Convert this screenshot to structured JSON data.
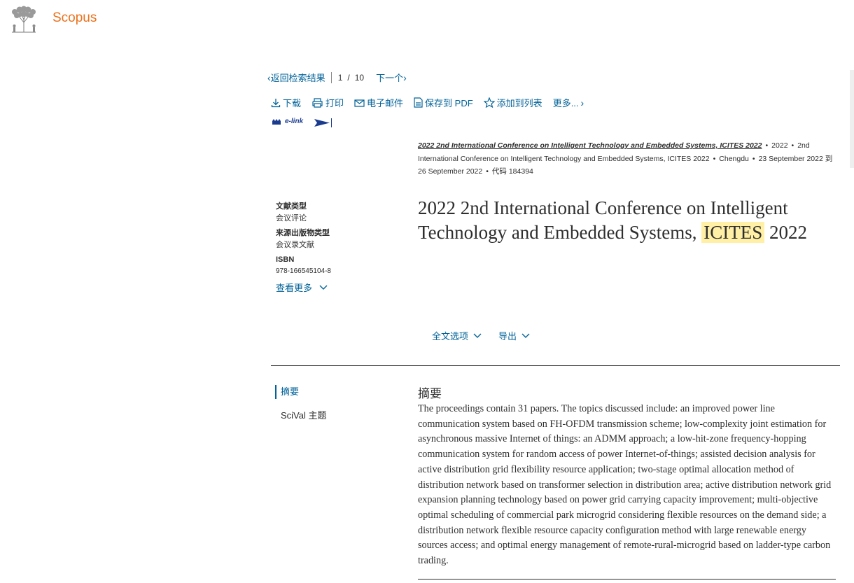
{
  "brand": "Scopus",
  "nav": {
    "back_label": "返回检索结果",
    "pager_current": "1",
    "pager_sep": "/",
    "pager_total": "10",
    "next_label": "下一个"
  },
  "actions": {
    "download": "下载",
    "print": "打印",
    "email": "电子邮件",
    "pdf": "保存到 PDF",
    "add_list": "添加到列表",
    "more": "更多..."
  },
  "elink_label": "e-link",
  "source": {
    "title": "2022 2nd International Conference on Intelligent Technology and Embedded Systems, ICITES 2022",
    "year": "2022",
    "conference": "2nd International Conference on Intelligent Technology and Embedded Systems, ICITES 2022",
    "location": "Chengdu",
    "dates": "23 September 2022 到 26 September 2022",
    "code": "代码 184394"
  },
  "meta": {
    "doc_type_label": "文献类型",
    "doc_type_value": "会议评论",
    "source_type_label": "来源出版物类型",
    "source_type_value": "会议录文献",
    "isbn_label": "ISBN",
    "isbn_value": "978-166545104-8",
    "see_more": "查看更多"
  },
  "title": {
    "before": "2022 2nd International Conference on Intelligent Technology and Embedded Systems,",
    "highlight": "ICITES",
    "after": "2022"
  },
  "fulltext": {
    "options": "全文选项",
    "export": "导出"
  },
  "side_nav": {
    "abstract": "摘要",
    "scival": "SciVal 主题"
  },
  "abstract": {
    "heading": "摘要",
    "body": "The proceedings contain 31 papers. The topics discussed include: an improved power line communication system based on FH-OFDM transmission scheme; low-complexity joint estimation for asynchronous massive Internet of things: an ADMM approach; a low-hit-zone frequency-hopping communication system for random access of power Internet-of-things; assisted decision analysis for active distribution grid flexibility resource application; two-stage optimal allocation method of distribution network based on transformer selection in distribution area; active distribution network grid expansion planning technology based on power grid carrying capacity improvement; multi-objective optimal scheduling of commercial park microgrid considering flexible resources on the demand side; a distribution network flexible resource capacity configuration method with large renewable energy sources access; and optimal energy management of remote-rural-microgrid based on ladder-type carbon trading."
  },
  "colors": {
    "brand": "#e9711c",
    "link": "#006298",
    "highlight": "#fff0a6",
    "text": "#2e2e2e"
  },
  "icons": [
    "elsevier-tree-logo",
    "chevron-left-icon",
    "chevron-right-icon",
    "download-icon",
    "print-icon",
    "email-icon",
    "pdf-icon",
    "star-icon",
    "chevron-down-icon"
  ]
}
